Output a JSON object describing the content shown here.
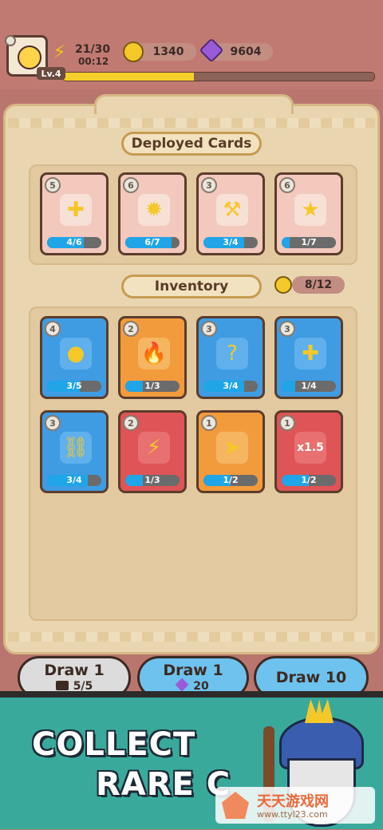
{
  "hud": {
    "level": "Lv.4",
    "energy": "21/30",
    "timer": "00:12",
    "coins": "1340",
    "gems": "9604",
    "xp_progress": 0.42
  },
  "deployed": {
    "title": "Deployed Cards",
    "cards": [
      {
        "level": "5",
        "count": "4/6",
        "fill": 0.67,
        "color": "pink",
        "icon": "shield-plus-icon"
      },
      {
        "level": "6",
        "count": "6/7",
        "fill": 0.86,
        "color": "pink",
        "icon": "gear-leaf-icon"
      },
      {
        "level": "3",
        "count": "3/4",
        "fill": 0.75,
        "color": "pink",
        "icon": "hammer-upgrade-icon"
      },
      {
        "level": "6",
        "count": "1/7",
        "fill": 0.14,
        "color": "pink",
        "icon": "hero-levelup-icon"
      }
    ]
  },
  "inventory": {
    "title": "Inventory",
    "capacity": "8/12",
    "cards": [
      {
        "level": "4",
        "count": "3/5",
        "fill": 0.6,
        "color": "blue",
        "icon": "coin-bag-icon"
      },
      {
        "level": "2",
        "count": "1/3",
        "fill": 0.33,
        "color": "orange",
        "icon": "fire-hero-icon"
      },
      {
        "level": "3",
        "count": "3/4",
        "fill": 0.75,
        "color": "blue",
        "icon": "mystery-hero-icon"
      },
      {
        "level": "3",
        "count": "1/4",
        "fill": 0.25,
        "color": "blue",
        "icon": "heal-drop-icon"
      },
      {
        "level": "3",
        "count": "3/4",
        "fill": 0.75,
        "color": "blue",
        "icon": "chain-lightning-icon"
      },
      {
        "level": "2",
        "count": "1/3",
        "fill": 0.33,
        "color": "red",
        "icon": "lightning-icon"
      },
      {
        "level": "1",
        "count": "1/2",
        "fill": 0.5,
        "color": "orange",
        "icon": "dash-hero-icon"
      },
      {
        "level": "1",
        "count": "1/2",
        "fill": 0.5,
        "color": "red",
        "icon": "speed-x15-icon"
      }
    ]
  },
  "draws": {
    "draw1_free": {
      "label": "Draw 1",
      "sub": "5/5"
    },
    "draw1_gem": {
      "label": "Draw 1",
      "sub": "20"
    },
    "draw10": {
      "label": "Draw 10"
    }
  },
  "promo": {
    "line1": "COLLECT",
    "line2": "RARE C"
  },
  "watermark": {
    "cn": "天天游戏网",
    "url": "www.ttyl23.com"
  },
  "icons": {
    "x15": "x1.5"
  }
}
